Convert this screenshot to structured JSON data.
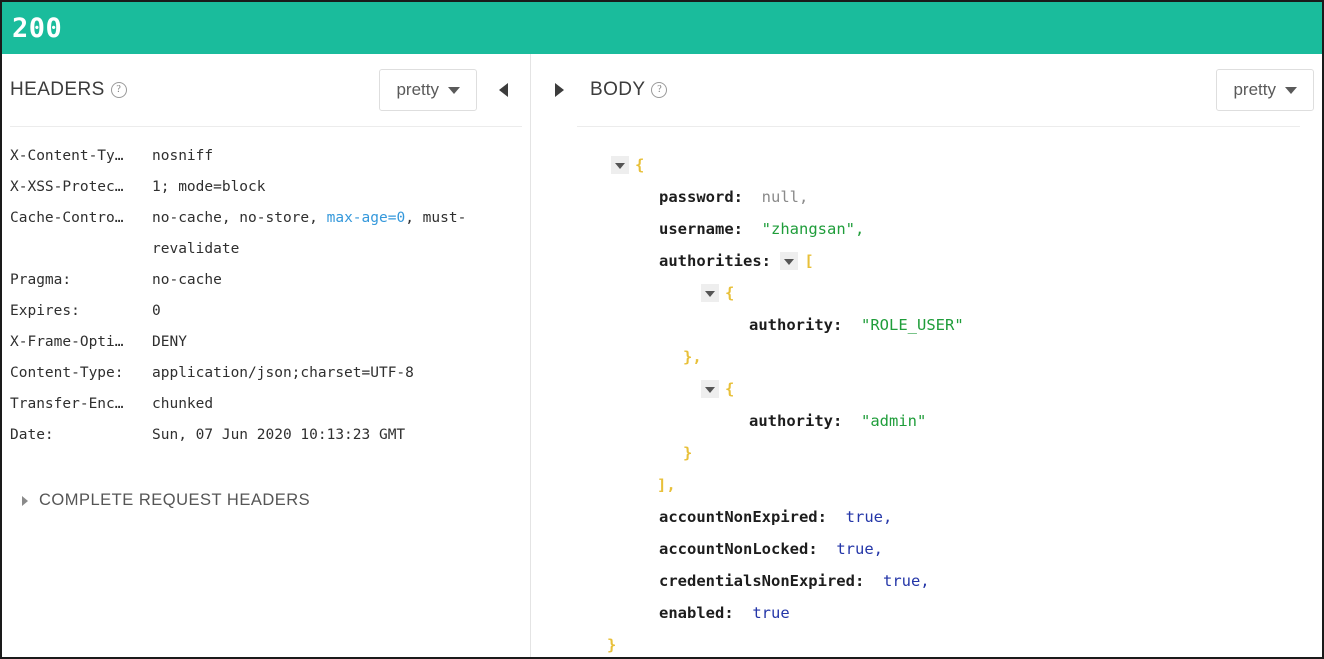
{
  "status": {
    "code": "200",
    "bar_color": "#1abc9c"
  },
  "left_panel": {
    "title": "HEADERS",
    "help_icon": "question-mark-circle-icon",
    "format_button": "pretty",
    "collapse_icon": "chevron-left-icon",
    "headers": [
      {
        "name": "X-Content-Ty…",
        "value": "nosniff"
      },
      {
        "name": "X-XSS-Protec…",
        "value": "1; mode=block"
      },
      {
        "name": "Cache-Contro…",
        "value_pre": "no-cache, no-store, ",
        "value_link": "max-age=0",
        "value_post": ", must-revalidate"
      },
      {
        "name": "Pragma:",
        "value": "no-cache"
      },
      {
        "name": "Expires:",
        "value": "0"
      },
      {
        "name": "X-Frame-Opti…",
        "value": "DENY"
      },
      {
        "name": "Content-Type:",
        "value": "application/json;charset=UTF-8"
      },
      {
        "name": "Transfer-Enc…",
        "value": "chunked"
      },
      {
        "name": "Date:",
        "value": "Sun, 07 Jun 2020 10:13:23 GMT"
      }
    ],
    "complete_request_headers": "COMPLETE REQUEST HEADERS"
  },
  "right_panel": {
    "expand_icon": "chevron-right-icon",
    "title": "BODY",
    "help_icon": "question-mark-circle-icon",
    "format_button": "pretty",
    "json": {
      "open_brace": "{",
      "password_key": "password",
      "password_value": "null,",
      "username_key": "username",
      "username_value": "\"zhangsan\",",
      "authorities_key": "authorities",
      "authorities_open": "[",
      "auth1_open": "{",
      "auth1_key": "authority",
      "auth1_value": "\"ROLE_USER\"",
      "auth1_close": "},",
      "auth2_open": "{",
      "auth2_key": "authority",
      "auth2_value": "\"admin\"",
      "auth2_close": "}",
      "authorities_close": "],",
      "accountNonExpired_key": "accountNonExpired",
      "accountNonExpired_value": "true,",
      "accountNonLocked_key": "accountNonLocked",
      "accountNonLocked_value": "true,",
      "credentialsNonExpired_key": "credentialsNonExpired",
      "credentialsNonExpired_value": "true,",
      "enabled_key": "enabled",
      "enabled_value": "true",
      "close_brace": "}",
      "colon": ":"
    }
  }
}
